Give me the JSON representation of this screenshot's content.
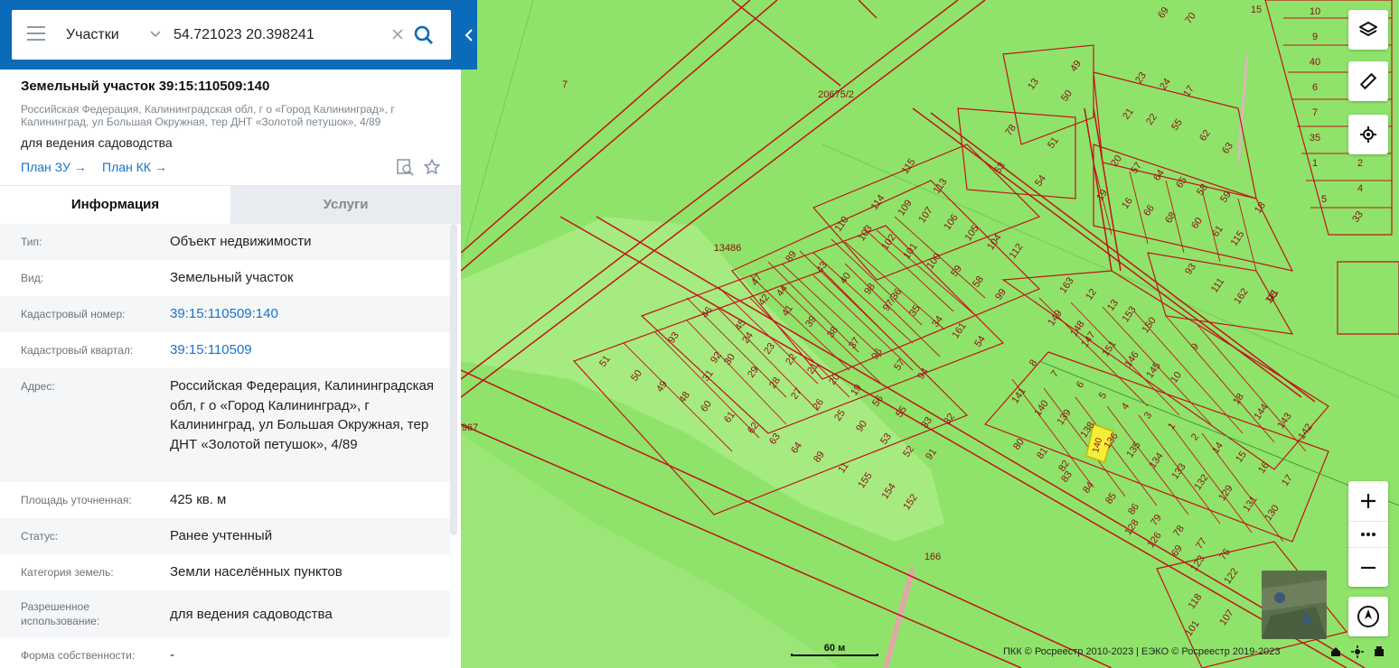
{
  "search": {
    "type_label": "Участки",
    "value": "54.721023 20.398241"
  },
  "object": {
    "title": "Земельный участок 39:15:110509:140",
    "address": "Российская Федерация, Калининградская обл, г о «Город Калининград», г Калининград, ул Большая Окружная, тер ДНТ «Золотой петушок», 4/89",
    "usage": "для ведения садоводства",
    "links": {
      "plan_zu": "План ЗУ →",
      "plan_kk": "План КК →"
    }
  },
  "tabs": {
    "info": "Информация",
    "services": "Услуги"
  },
  "info": [
    {
      "key": "Тип:",
      "value": "Объект недвижимости",
      "link": false
    },
    {
      "key": "Вид:",
      "value": "Земельный участок",
      "link": false
    },
    {
      "key": "Кадастровый номер:",
      "value": "39:15:110509:140",
      "link": true
    },
    {
      "key": "Кадастровый квартал:",
      "value": "39:15:110509",
      "link": true
    },
    {
      "key": "Адрес:",
      "value": "Российская Федерация, Калининградская обл, г о «Город Калининград», г Калининград, ул Большая Окружная, тер ДНТ «Золотой петушок», 4/89",
      "link": false
    },
    {
      "key": "Площадь уточненная:",
      "value": "425 кв. м",
      "link": false
    },
    {
      "key": "Статус:",
      "value": "Ранее учтенный",
      "link": false
    },
    {
      "key": "Категория земель:",
      "value": "Земли населённых пунктов",
      "link": false
    },
    {
      "key": "Разрешенное использование:",
      "value": "для ведения садоводства",
      "link": false
    },
    {
      "key": "Форма собственности:",
      "value": "-",
      "link": false
    }
  ],
  "map": {
    "scale_label": "60 м",
    "copyright": "ПКК © Росреестр 2010-2023 | ЕЭКО © Росреестр 2019-2023",
    "parcel_labels": [
      "7",
      "20675/2",
      "13486",
      "967",
      "166",
      "15",
      "10",
      "9",
      "40",
      "6",
      "7",
      "35",
      "1",
      "2",
      "4",
      "5",
      "33",
      "69",
      "70",
      "49",
      "50",
      "13",
      "23",
      "24",
      "17",
      "21",
      "22",
      "55",
      "62",
      "63",
      "78",
      "51",
      "53",
      "54",
      "20",
      "57",
      "64",
      "65",
      "58",
      "59",
      "18",
      "115",
      "113",
      "19",
      "16",
      "66",
      "68",
      "60",
      "61",
      "115",
      "111",
      "114",
      "109",
      "107",
      "106",
      "105",
      "104",
      "112",
      "110",
      "103",
      "102",
      "101",
      "100",
      "59",
      "58",
      "99",
      "89",
      "93",
      "111",
      "162",
      "95",
      "47",
      "44",
      "43",
      "40",
      "98",
      "97/36",
      "35",
      "34",
      "161",
      "54",
      "46",
      "45",
      "42",
      "41",
      "39",
      "38",
      "37",
      "96",
      "57",
      "94",
      "93",
      "92",
      "24",
      "23",
      "22",
      "21",
      "20",
      "19",
      "56",
      "55",
      "33",
      "32",
      "31",
      "30",
      "29",
      "28",
      "27",
      "26",
      "25",
      "90",
      "53",
      "52",
      "91",
      "51",
      "50",
      "49",
      "48",
      "60",
      "61",
      "62",
      "63",
      "64",
      "89",
      "11",
      "155",
      "154",
      "152",
      "163",
      "12",
      "13",
      "153",
      "150",
      "149",
      "148",
      "147",
      "151",
      "146",
      "145",
      "10",
      "9",
      "8",
      "7",
      "6",
      "5",
      "4",
      "3",
      "1",
      "2",
      "14",
      "15",
      "16",
      "17",
      "18",
      "144",
      "143",
      "142",
      "141",
      "140",
      "139",
      "138",
      "136",
      "135",
      "134",
      "133",
      "132",
      "129",
      "131",
      "130",
      "80",
      "81",
      "82",
      "83",
      "84",
      "85",
      "86",
      "79",
      "78",
      "77",
      "76",
      "128",
      "126",
      "69",
      "123",
      "122",
      "118",
      "107",
      "101"
    ],
    "selected_parcel": "140",
    "colors": {
      "map_background": "#8fe36a",
      "light_area": "#a6eb80",
      "parcel_border": "#c0141a",
      "selected_parcel_fill": "#f5ef3a",
      "header_blue": "#0b6bb8"
    }
  },
  "icons": {
    "menu": "menu-icon",
    "chevron": "chevron-down-icon",
    "clear": "close-icon",
    "search": "search-icon",
    "collapse": "chevron-left-icon",
    "find_on_map": "find-on-map-icon",
    "favorite": "star-icon",
    "layers": "layers-icon",
    "ruler": "ruler-icon",
    "locate": "locate-icon",
    "zoom_in": "plus-icon",
    "more": "more-icon",
    "zoom_out": "minus-icon",
    "compass": "compass-icon"
  }
}
